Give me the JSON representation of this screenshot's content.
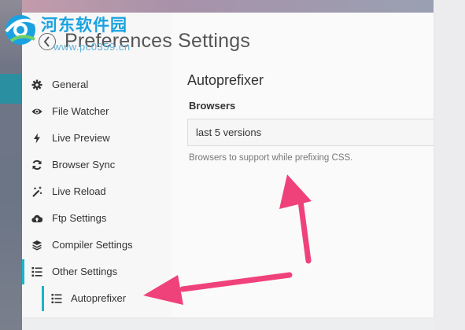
{
  "window": {
    "title": "Preferences Settings"
  },
  "watermark": {
    "name": "河东软件园",
    "url": "www.pc0359.cn"
  },
  "sidebar": {
    "items": [
      {
        "label": "General",
        "icon": "gear-icon"
      },
      {
        "label": "File Watcher",
        "icon": "eye-icon"
      },
      {
        "label": "Live Preview",
        "icon": "bolt-icon"
      },
      {
        "label": "Browser Sync",
        "icon": "refresh-icon"
      },
      {
        "label": "Live Reload",
        "icon": "magic-wand-icon"
      },
      {
        "label": "Ftp Settings",
        "icon": "cloud-upload-icon"
      },
      {
        "label": "Compiler Settings",
        "icon": "layers-icon"
      },
      {
        "label": "Other Settings",
        "icon": "list-icon"
      }
    ],
    "sub_items": [
      {
        "label": "Autoprefixer",
        "icon": "list-icon"
      }
    ]
  },
  "main": {
    "section_title": "Autoprefixer",
    "field_label": "Browsers",
    "field_value": "last 5 versions",
    "field_help": "Browsers to support while prefixing CSS."
  },
  "colors": {
    "accent": "#19b5c7",
    "annotation_arrow": "#f0427a"
  }
}
